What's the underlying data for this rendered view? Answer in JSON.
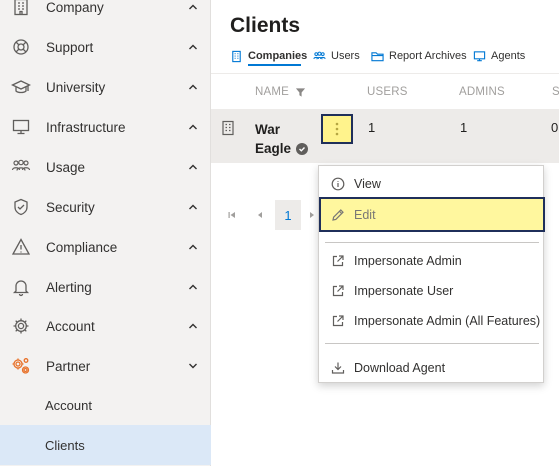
{
  "sidebar": {
    "items": [
      {
        "label": "Company",
        "icon": "building-icon",
        "chevron": "up"
      },
      {
        "label": "Support",
        "icon": "lifebuoy-icon",
        "chevron": "up"
      },
      {
        "label": "University",
        "icon": "graduation-cap-icon",
        "chevron": "up"
      },
      {
        "label": "Infrastructure",
        "icon": "monitor-icon",
        "chevron": "up"
      },
      {
        "label": "Usage",
        "icon": "people-icon",
        "chevron": "up"
      },
      {
        "label": "Security",
        "icon": "shield-icon",
        "chevron": "up"
      },
      {
        "label": "Compliance",
        "icon": "warning-icon",
        "chevron": "up"
      },
      {
        "label": "Alerting",
        "icon": "bell-icon",
        "chevron": "up"
      },
      {
        "label": "Account",
        "icon": "gear-icon",
        "chevron": "up"
      },
      {
        "label": "Partner",
        "icon": "partner-gears-icon",
        "chevron": "down",
        "icon_color": "#e8722a"
      }
    ],
    "subitems": [
      {
        "label": "Account",
        "active": false
      },
      {
        "label": "Clients",
        "active": true
      }
    ]
  },
  "main": {
    "title": "Clients",
    "tabs": [
      {
        "label": "Companies",
        "icon": "building-icon",
        "active": true
      },
      {
        "label": "Users",
        "icon": "people-icon",
        "active": false
      },
      {
        "label": "Report Archives",
        "icon": "folder-icon",
        "active": false
      },
      {
        "label": "Agents",
        "icon": "monitor-icon",
        "active": false
      }
    ],
    "table": {
      "columns": [
        "NAME",
        "USERS",
        "ADMINS",
        "S"
      ],
      "rows": [
        {
          "name_line1": "War",
          "name_line2": "Eagle",
          "users": "1",
          "admins": "1",
          "s": "0"
        }
      ]
    },
    "pagination": {
      "current_page": "1"
    }
  },
  "context_menu": {
    "items": [
      {
        "label": "View",
        "icon": "info-icon"
      },
      {
        "label": "Edit",
        "icon": "pencil-icon",
        "highlighted": true
      },
      {
        "label": "Impersonate Admin",
        "icon": "external-link-icon"
      },
      {
        "label": "Impersonate User",
        "icon": "external-link-icon"
      },
      {
        "label": "Impersonate Admin (All Features)",
        "icon": "external-link-icon"
      },
      {
        "label": "Download Agent",
        "icon": "download-icon"
      }
    ]
  },
  "colors": {
    "accent": "#0078d4",
    "highlight": "#fff79e",
    "highlight_border": "#1f2f5a",
    "partner_icon": "#e8722a",
    "sidebar_bg": "#f3f2f1",
    "active_subitem_bg": "#dbe8f7"
  }
}
